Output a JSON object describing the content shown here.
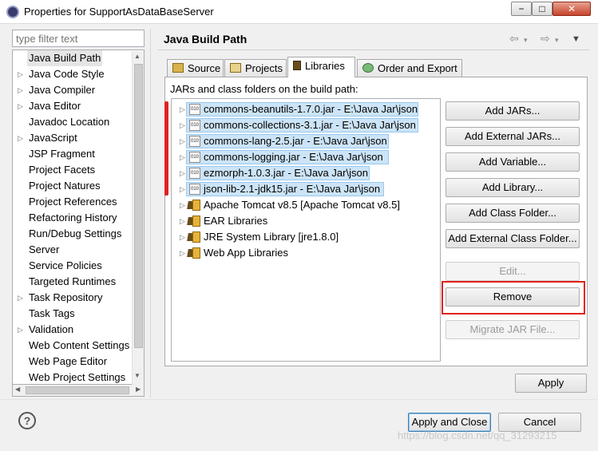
{
  "window": {
    "title": "Properties for SupportAsDataBaseServer",
    "min_label": "−",
    "max_label": "□",
    "close_label": "✕"
  },
  "filter": {
    "placeholder": "type filter text"
  },
  "tree": {
    "items": [
      {
        "label": "Java Build Path",
        "expandable": false,
        "selected": true
      },
      {
        "label": "Java Code Style",
        "expandable": true
      },
      {
        "label": "Java Compiler",
        "expandable": true
      },
      {
        "label": "Java Editor",
        "expandable": true
      },
      {
        "label": "Javadoc Location",
        "expandable": false
      },
      {
        "label": "JavaScript",
        "expandable": true
      },
      {
        "label": "JSP Fragment",
        "expandable": false
      },
      {
        "label": "Project Facets",
        "expandable": false
      },
      {
        "label": "Project Natures",
        "expandable": false
      },
      {
        "label": "Project References",
        "expandable": false
      },
      {
        "label": "Refactoring History",
        "expandable": false
      },
      {
        "label": "Run/Debug Settings",
        "expandable": false
      },
      {
        "label": "Server",
        "expandable": false
      },
      {
        "label": "Service Policies",
        "expandable": false
      },
      {
        "label": "Targeted Runtimes",
        "expandable": false
      },
      {
        "label": "Task Repository",
        "expandable": true
      },
      {
        "label": "Task Tags",
        "expandable": false
      },
      {
        "label": "Validation",
        "expandable": true
      },
      {
        "label": "Web Content Settings",
        "expandable": false
      },
      {
        "label": "Web Page Editor",
        "expandable": false
      },
      {
        "label": "Web Project Settings",
        "expandable": false
      }
    ]
  },
  "page": {
    "title": "Java Build Path",
    "tabs": [
      {
        "label": "Source",
        "icon": "source-folder-icon"
      },
      {
        "label": "Projects",
        "icon": "projects-icon"
      },
      {
        "label": "Libraries",
        "icon": "libraries-icon",
        "active": true
      },
      {
        "label": "Order and Export",
        "icon": "order-export-icon"
      }
    ],
    "jars_label": "JARs and class folders on the build path:",
    "entries": [
      {
        "label": "commons-beanutils-1.7.0.jar - E:\\Java Jar\\json",
        "kind": "jar",
        "selected": true
      },
      {
        "label": "commons-collections-3.1.jar - E:\\Java Jar\\json",
        "kind": "jar",
        "selected": true
      },
      {
        "label": "commons-lang-2.5.jar - E:\\Java Jar\\json",
        "kind": "jar",
        "selected": true
      },
      {
        "label": "commons-logging.jar - E:\\Java Jar\\json",
        "kind": "jar",
        "selected": true
      },
      {
        "label": "ezmorph-1.0.3.jar - E:\\Java Jar\\json",
        "kind": "jar",
        "selected": true
      },
      {
        "label": "json-lib-2.1-jdk15.jar - E:\\Java Jar\\json",
        "kind": "jar",
        "selected": true
      },
      {
        "label": "Apache Tomcat v8.5 [Apache Tomcat v8.5]",
        "kind": "library"
      },
      {
        "label": "EAR Libraries",
        "kind": "library"
      },
      {
        "label": "JRE System Library [jre1.8.0]",
        "kind": "library"
      },
      {
        "label": "Web App Libraries",
        "kind": "library"
      }
    ],
    "jar_icon_text": "010",
    "buttons": {
      "add_jars": "Add JARs...",
      "add_external_jars": "Add External JARs...",
      "add_variable": "Add Variable...",
      "add_library": "Add Library...",
      "add_class_folder": "Add Class Folder...",
      "add_external_class_folder": "Add External Class Folder...",
      "edit": "Edit...",
      "remove": "Remove",
      "migrate_jar": "Migrate JAR File..."
    },
    "apply": "Apply"
  },
  "footer": {
    "help": "?",
    "apply_and_close": "Apply and Close",
    "cancel": "Cancel"
  },
  "watermark": "https://blog.csdn.net/qq_31293215",
  "colors": {
    "selection": "#cce4f7",
    "highlight_red": "#e0201a"
  }
}
